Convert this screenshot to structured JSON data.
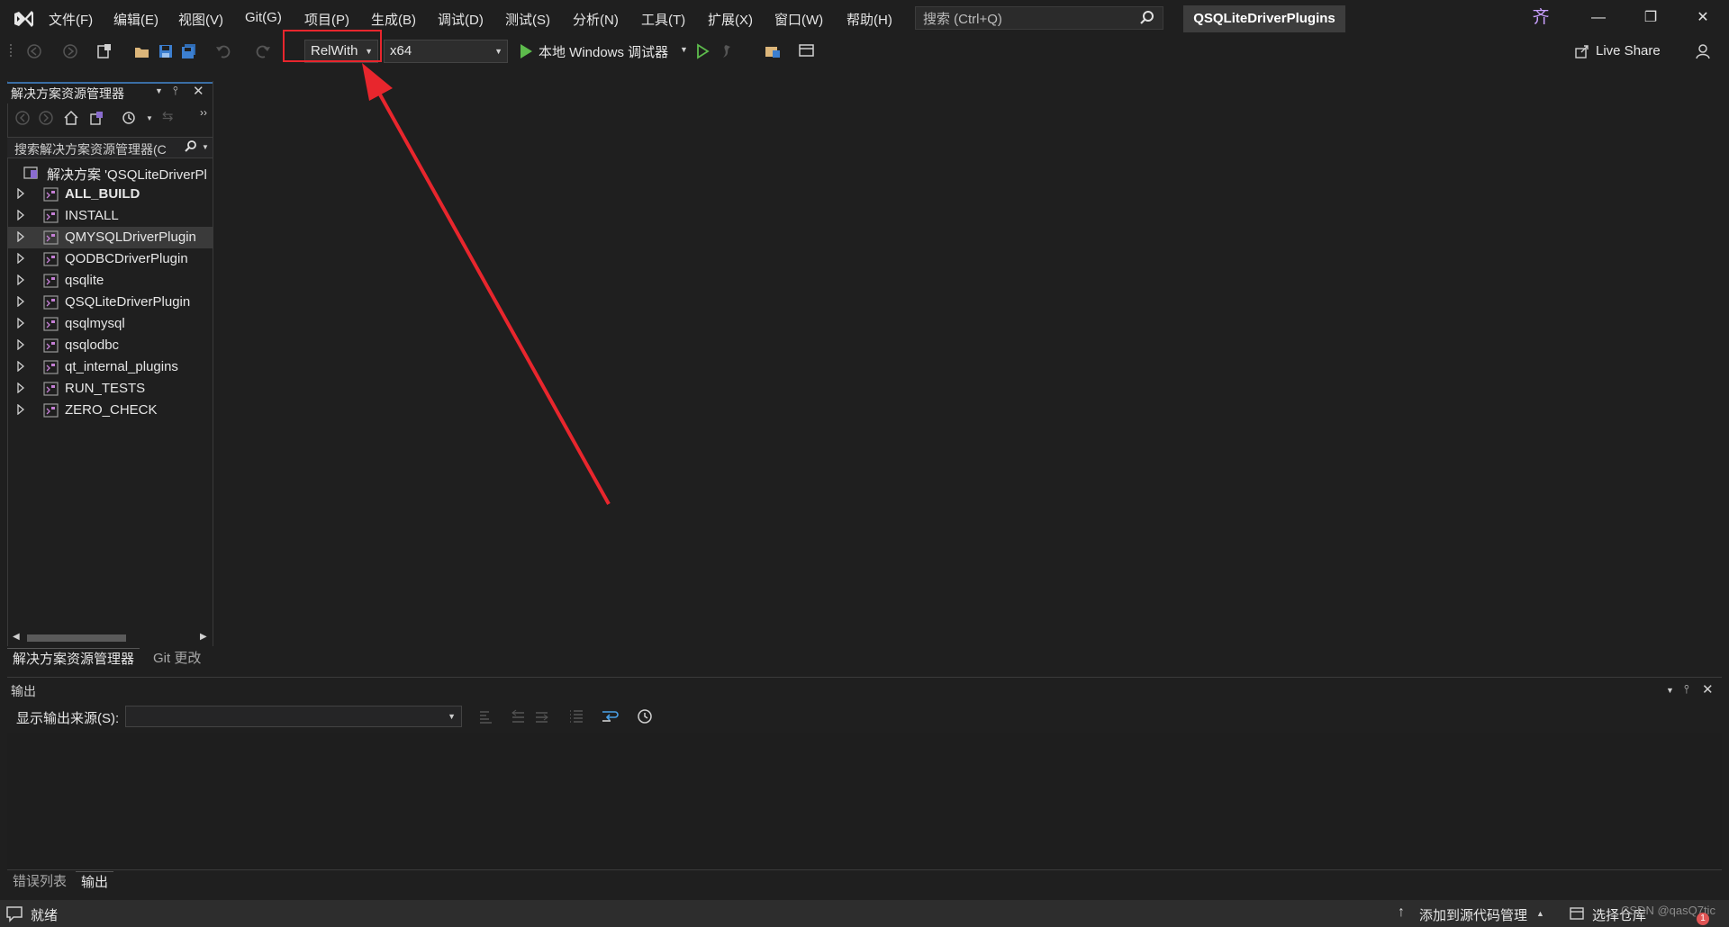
{
  "menubar": {
    "items": [
      "文件(F)",
      "编辑(E)",
      "视图(V)",
      "Git(G)",
      "项目(P)",
      "生成(B)",
      "调试(D)",
      "测试(S)",
      "分析(N)",
      "工具(T)",
      "扩展(X)",
      "窗口(W)",
      "帮助(H)"
    ]
  },
  "search": {
    "placeholder": "搜索 (Ctrl+Q)"
  },
  "solution_name": "QSQLiteDriverPlugins",
  "avatar_initial": "齐",
  "toolbar": {
    "configuration": "RelWith",
    "platform": "x64",
    "debugger_label": "本地 Windows 调试器",
    "live_share": "Live Share"
  },
  "solution_explorer": {
    "title": "解决方案资源管理器",
    "search_placeholder": "搜索解决方案资源管理器(C",
    "root": "解决方案 'QSQLiteDriverPl",
    "projects": [
      {
        "name": "ALL_BUILD",
        "bold": true,
        "selected": false
      },
      {
        "name": "INSTALL",
        "bold": false,
        "selected": false
      },
      {
        "name": "QMYSQLDriverPlugin",
        "bold": false,
        "selected": true
      },
      {
        "name": "QODBCDriverPlugin",
        "bold": false,
        "selected": false
      },
      {
        "name": "qsqlite",
        "bold": false,
        "selected": false
      },
      {
        "name": "QSQLiteDriverPlugin",
        "bold": false,
        "selected": false
      },
      {
        "name": "qsqlmysql",
        "bold": false,
        "selected": false
      },
      {
        "name": "qsqlodbc",
        "bold": false,
        "selected": false
      },
      {
        "name": "qt_internal_plugins",
        "bold": false,
        "selected": false
      },
      {
        "name": "RUN_TESTS",
        "bold": false,
        "selected": false
      },
      {
        "name": "ZERO_CHECK",
        "bold": false,
        "selected": false
      }
    ],
    "tabs": [
      "解决方案资源管理器",
      "Git 更改"
    ]
  },
  "output": {
    "title": "输出",
    "source_label": "显示输出来源(S):",
    "source_value": "",
    "tabs": [
      "错误列表",
      "输出"
    ]
  },
  "statusbar": {
    "ready": "就绪",
    "add_to_source_control": "添加到源代码管理",
    "select_repo": "选择仓库",
    "watermark": "CSDN @qasQ7tic",
    "notification_count": "1"
  },
  "colors": {
    "annotation_red": "#e8262d",
    "accent_blue": "#3a6ea5",
    "run_green": "#5dbb4c"
  }
}
